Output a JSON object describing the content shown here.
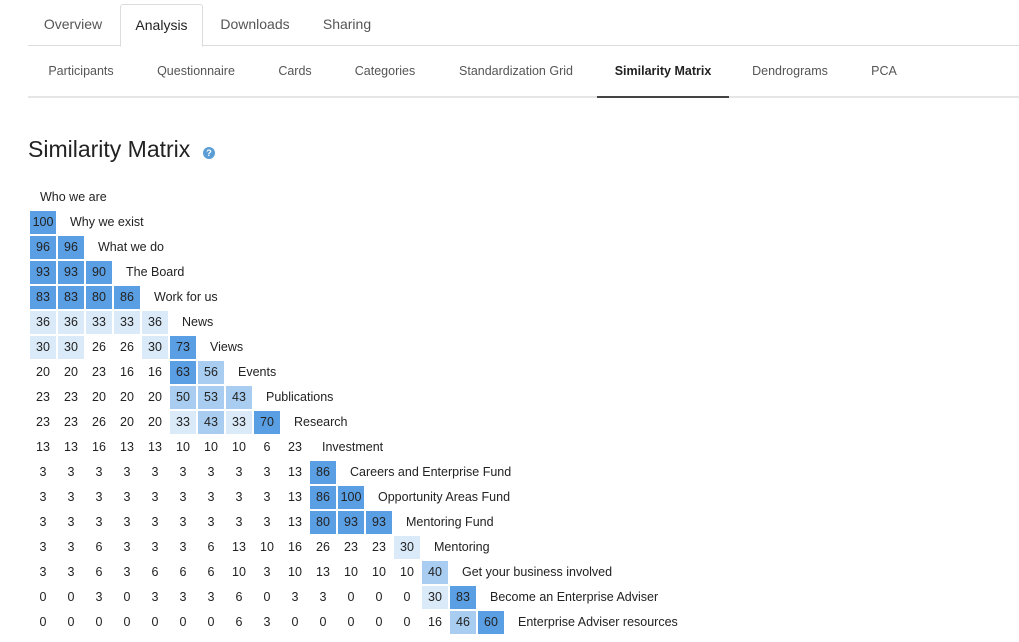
{
  "top_tabs": [
    {
      "label": "Overview",
      "active": false
    },
    {
      "label": "Analysis",
      "active": true
    },
    {
      "label": "Downloads",
      "active": false
    },
    {
      "label": "Sharing",
      "active": false
    }
  ],
  "sub_tabs": [
    {
      "label": "Participants",
      "active": false
    },
    {
      "label": "Questionnaire",
      "active": false
    },
    {
      "label": "Cards",
      "active": false
    },
    {
      "label": "Categories",
      "active": false
    },
    {
      "label": "Standardization Grid",
      "active": false
    },
    {
      "label": "Similarity Matrix",
      "active": true
    },
    {
      "label": "Dendrograms",
      "active": false
    },
    {
      "label": "PCA",
      "active": false
    }
  ],
  "page_title": "Similarity Matrix",
  "help_icon": "question-circle-icon",
  "colors": {
    "high": "#5a9fe3",
    "mid": "#a9cdf0",
    "low": "#dbeaf8",
    "accent": "#5b9ed6"
  },
  "matrix": {
    "first_label": "Who we are",
    "rows": [
      {
        "label": "Why we exist",
        "values": [
          100
        ]
      },
      {
        "label": "What we do",
        "values": [
          96,
          96
        ]
      },
      {
        "label": "The Board",
        "values": [
          93,
          93,
          90
        ]
      },
      {
        "label": "Work for us",
        "values": [
          83,
          83,
          80,
          86
        ]
      },
      {
        "label": "News",
        "values": [
          36,
          36,
          33,
          33,
          36
        ]
      },
      {
        "label": "Views",
        "values": [
          30,
          30,
          26,
          26,
          30,
          73
        ]
      },
      {
        "label": "Events",
        "values": [
          20,
          20,
          23,
          16,
          16,
          63,
          56
        ]
      },
      {
        "label": "Publications",
        "values": [
          23,
          23,
          20,
          20,
          20,
          50,
          53,
          43
        ]
      },
      {
        "label": "Research",
        "values": [
          23,
          23,
          26,
          20,
          20,
          33,
          43,
          33,
          70
        ]
      },
      {
        "label": "Investment",
        "values": [
          13,
          13,
          16,
          13,
          13,
          10,
          10,
          10,
          6,
          23
        ]
      },
      {
        "label": "Careers and Enterprise Fund",
        "values": [
          3,
          3,
          3,
          3,
          3,
          3,
          3,
          3,
          3,
          13,
          86
        ]
      },
      {
        "label": "Opportunity Areas Fund",
        "values": [
          3,
          3,
          3,
          3,
          3,
          3,
          3,
          3,
          3,
          13,
          86,
          100
        ]
      },
      {
        "label": "Mentoring Fund",
        "values": [
          3,
          3,
          3,
          3,
          3,
          3,
          3,
          3,
          3,
          13,
          80,
          93,
          93
        ]
      },
      {
        "label": "Mentoring",
        "values": [
          3,
          3,
          6,
          3,
          3,
          3,
          6,
          13,
          10,
          16,
          26,
          23,
          23,
          30
        ]
      },
      {
        "label": "Get your business involved",
        "values": [
          3,
          3,
          6,
          3,
          6,
          6,
          6,
          10,
          3,
          10,
          13,
          10,
          10,
          10,
          40
        ]
      },
      {
        "label": "Become an Enterprise Adviser",
        "values": [
          0,
          0,
          3,
          0,
          3,
          3,
          3,
          6,
          0,
          3,
          3,
          0,
          0,
          0,
          30,
          83
        ]
      },
      {
        "label": "Enterprise Adviser resources",
        "values": [
          0,
          0,
          0,
          0,
          0,
          0,
          0,
          6,
          3,
          0,
          0,
          0,
          0,
          0,
          16,
          46,
          60
        ]
      }
    ]
  }
}
